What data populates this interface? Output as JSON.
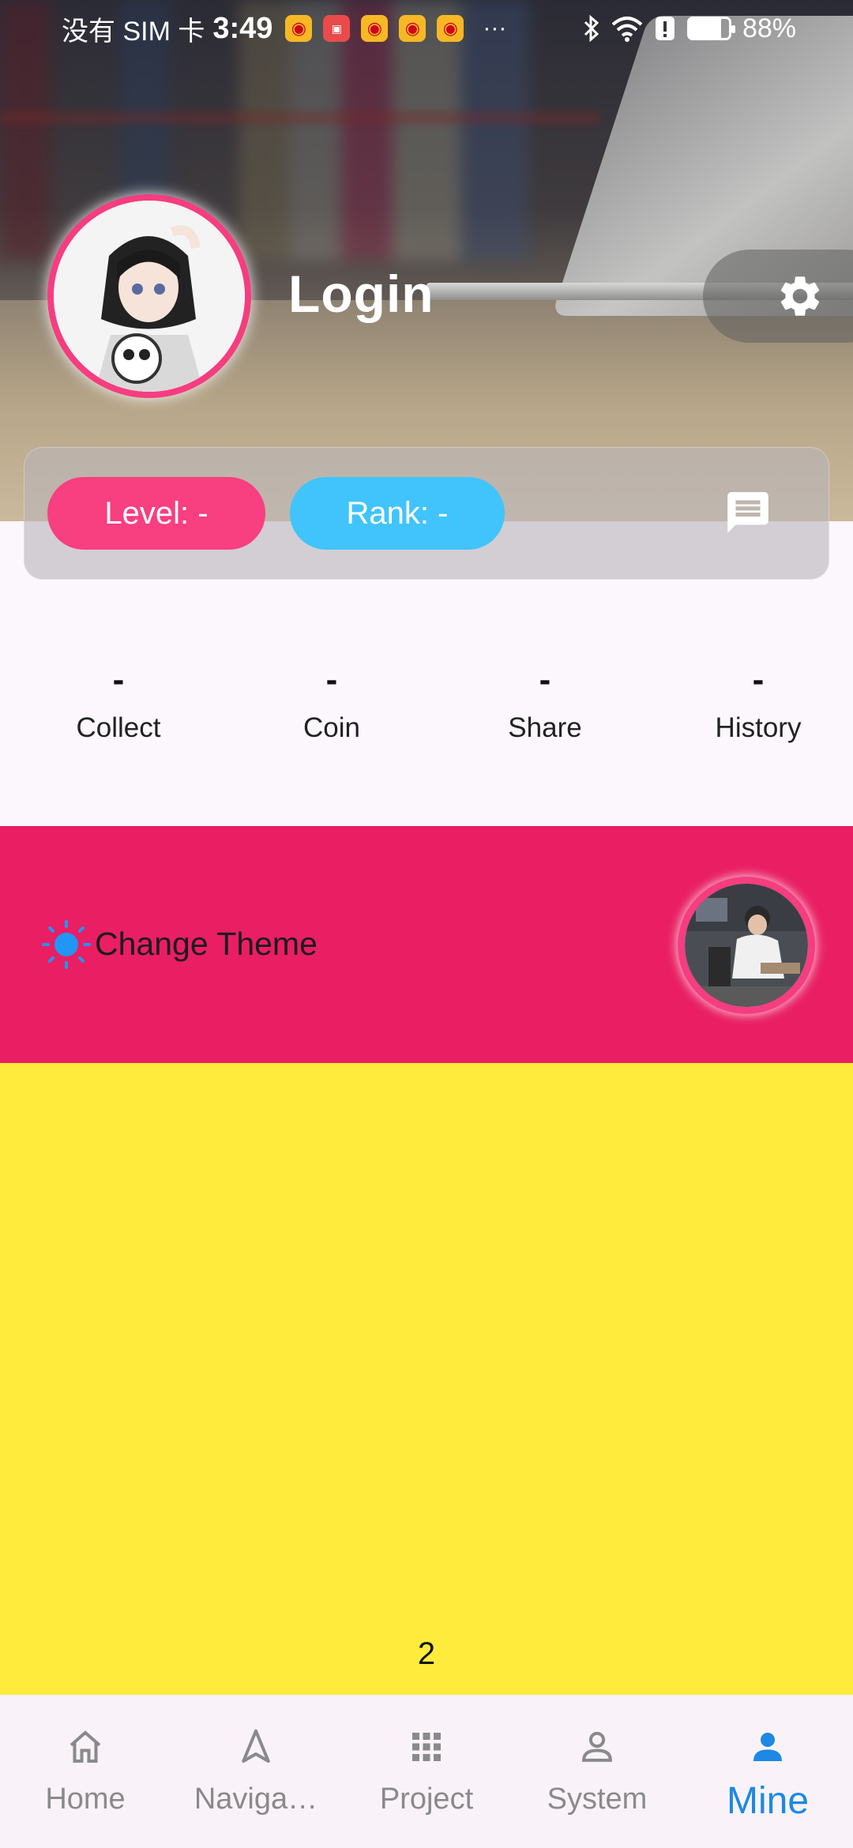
{
  "status_bar": {
    "carrier": "没有 SIM 卡",
    "time": "3:49",
    "notification_icons": [
      "weibo-icon",
      "huawei-store-icon",
      "weibo-icon",
      "weibo-icon",
      "weibo-icon"
    ],
    "more": "···",
    "battery": "88%"
  },
  "profile": {
    "login_label": "Login",
    "level_label": "Level:  -",
    "rank_label": "Rank:  -"
  },
  "stats": [
    {
      "value": "-",
      "label": "Collect"
    },
    {
      "value": "-",
      "label": "Coin"
    },
    {
      "value": "-",
      "label": "Share"
    },
    {
      "value": "-",
      "label": "History"
    }
  ],
  "theme": {
    "label": "Change Theme"
  },
  "content": {
    "page_number": "2"
  },
  "bottom_nav": [
    {
      "label": "Home",
      "icon": "home-icon",
      "active": false
    },
    {
      "label": "Naviga…",
      "icon": "navigation-icon",
      "active": false
    },
    {
      "label": "Project",
      "icon": "grid-icon",
      "active": false
    },
    {
      "label": "System",
      "icon": "person-outline-icon",
      "active": false
    },
    {
      "label": "Mine",
      "icon": "person-icon",
      "active": true
    }
  ],
  "colors": {
    "accent_pink": "#e91e63",
    "level_pill": "#f83f7f",
    "rank_pill": "#40c4fb",
    "content_yellow": "#ffeb3b",
    "nav_active": "#1e88e5",
    "nav_inactive": "#8a8a8a"
  }
}
